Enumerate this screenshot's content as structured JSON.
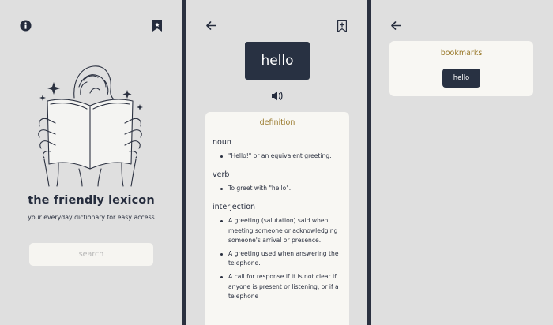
{
  "home": {
    "title": "the friendly lexicon",
    "tagline": "your everyday dictionary for easy access",
    "search_placeholder": "search"
  },
  "definition_screen": {
    "word": "hello",
    "section_title": "definition",
    "entries": [
      {
        "part_of_speech": "noun",
        "definitions": [
          "\"Hello!\" or an equivalent greeting."
        ]
      },
      {
        "part_of_speech": "verb",
        "definitions": [
          "To greet with \"hello\"."
        ]
      },
      {
        "part_of_speech": "interjection",
        "definitions": [
          "A greeting (salutation) said when meeting someone or acknowledging someone's arrival or presence.",
          "A greeting used when answering the telephone.",
          "A call for response if it is not clear if anyone is present or listening, or if a telephone"
        ]
      }
    ]
  },
  "bookmarks_screen": {
    "title": "bookmarks",
    "items": [
      "hello"
    ]
  },
  "icons": {
    "info": "info-icon",
    "bookmark": "bookmark-icon",
    "back": "back-arrow-icon",
    "add_bookmark": "bookmark-add-icon",
    "speaker": "speaker-icon"
  },
  "colors": {
    "background": "#dfdfdf",
    "frame": "#2b3140",
    "navy": "#283142",
    "card": "#f8f7f3",
    "accent_gold": "#9a7a2c"
  }
}
